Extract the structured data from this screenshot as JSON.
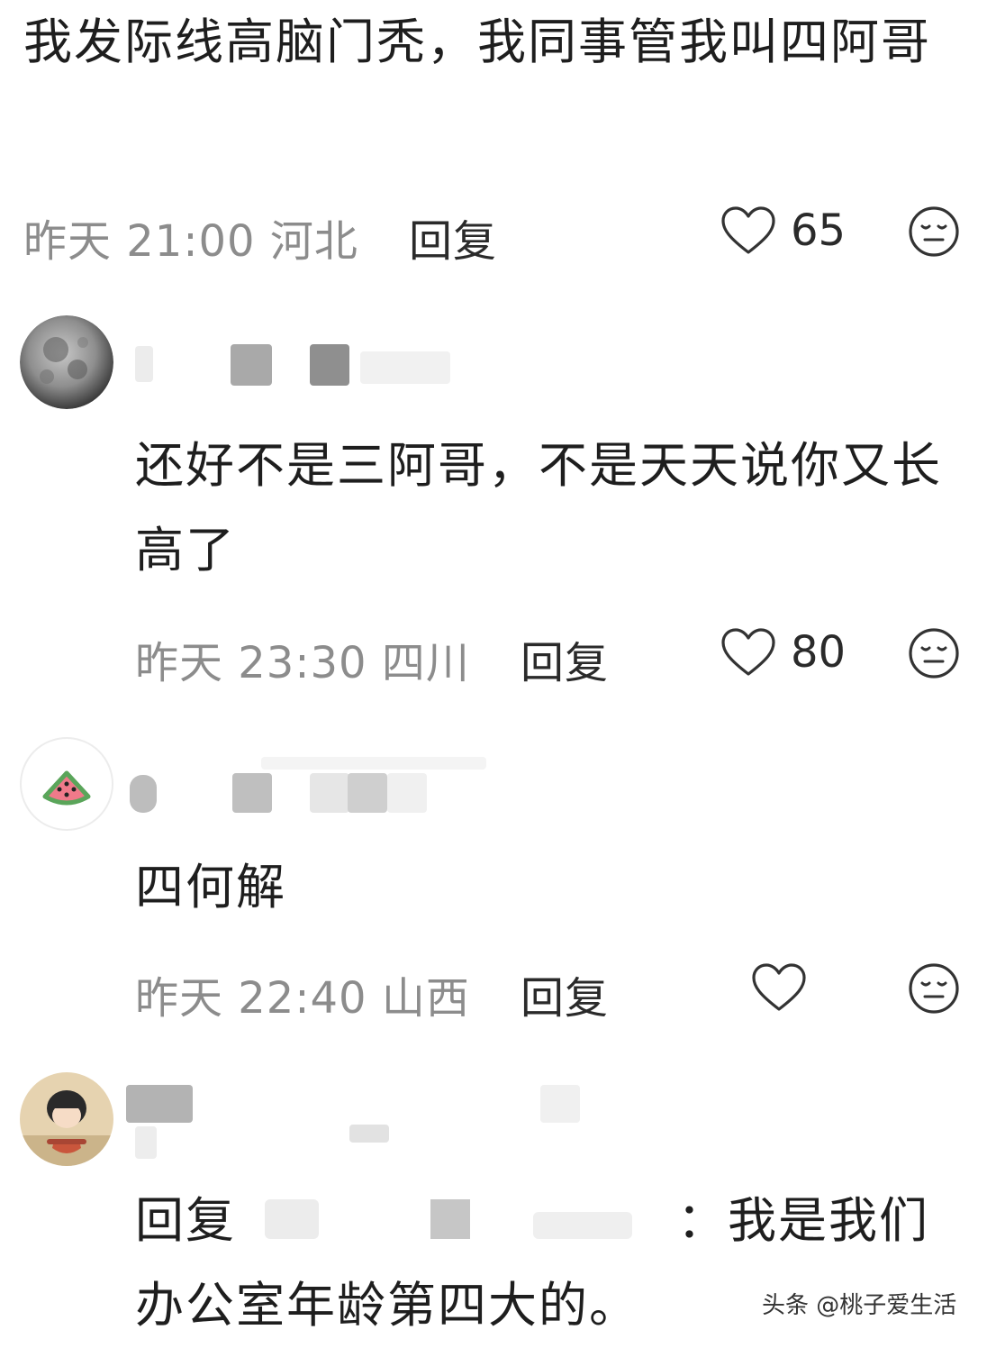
{
  "comments": [
    {
      "text": "我发际线高脑门秃，我同事管我叫四阿哥",
      "time": "昨天 21:00 河北",
      "reply_label": "回复",
      "likes": "65",
      "like_icon": "heart-outline-icon",
      "emoji_icon": "neutral-face-icon"
    },
    {
      "avatar_icon": "moon-avatar",
      "text": "还好不是三阿哥，不是天天说你又长高了",
      "time": "昨天 23:30 四川",
      "reply_label": "回复",
      "likes": "80",
      "like_icon": "heart-outline-icon",
      "emoji_icon": "neutral-face-icon"
    },
    {
      "avatar_icon": "watermelon-avatar",
      "text": "四何解",
      "time": "昨天 22:40 山西",
      "reply_label": "回复",
      "likes": "",
      "like_icon": "heart-outline-icon",
      "emoji_icon": "neutral-face-icon"
    },
    {
      "avatar_icon": "cartoon-girl-avatar",
      "reply_prefix": "回复",
      "text_suffix": "：我是我们办公室年龄第四大的。"
    }
  ],
  "watermark": "头条 @桃子爱生活",
  "colors": {
    "text": "#1e1e1e",
    "meta": "#8c8c8c",
    "background": "#ffffff"
  }
}
